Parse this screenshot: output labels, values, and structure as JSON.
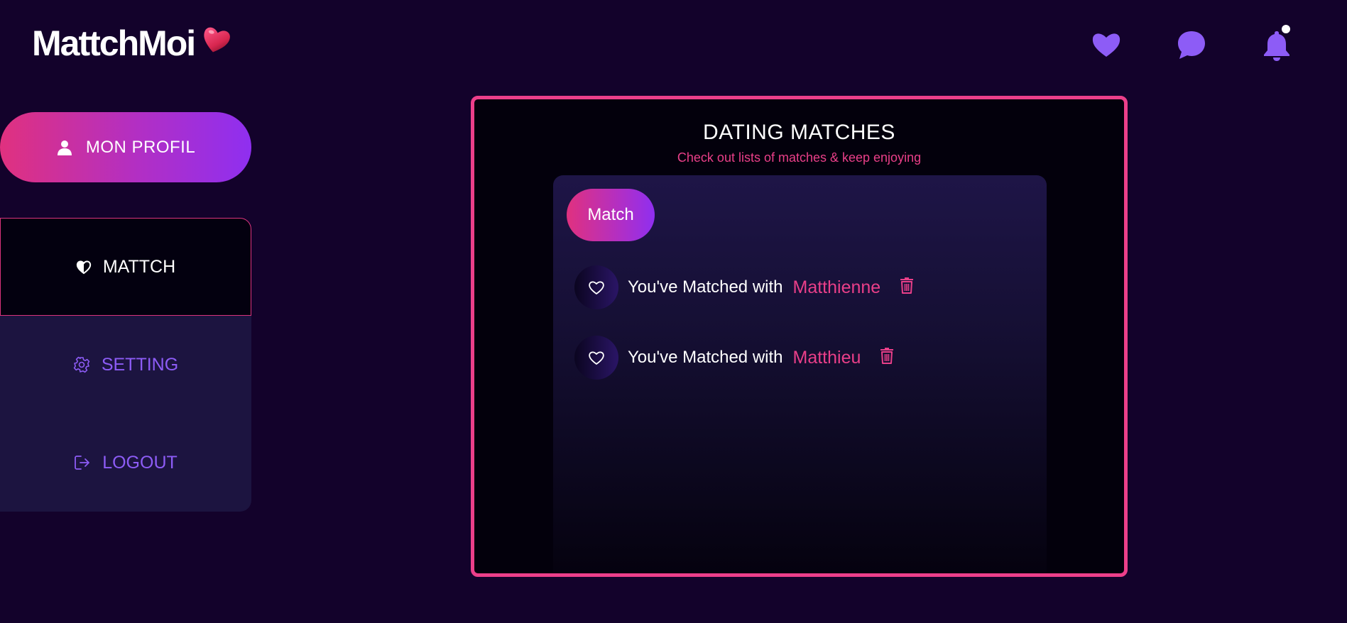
{
  "app": {
    "logo_text": "MattchMoi"
  },
  "colors": {
    "background": "#13022b",
    "accent_pink": "#ec3f8a",
    "accent_purple": "#8d5cf6",
    "gradient_start": "#e0317f",
    "gradient_end": "#8f2ff0"
  },
  "header": {
    "icons": [
      "heart-icon",
      "chat-bubble-icon",
      "bell-icon"
    ],
    "has_notification": true
  },
  "sidebar": {
    "profile_button": {
      "label": "MON PROFIL",
      "icon": "user-icon"
    },
    "items": [
      {
        "label": "MATTCH",
        "icon": "heart-shield-icon",
        "active": true
      },
      {
        "label": "SETTING",
        "icon": "gear-icon",
        "active": false
      },
      {
        "label": "LOGOUT",
        "icon": "logout-icon",
        "active": false
      }
    ]
  },
  "main": {
    "title": "DATING MATCHES",
    "subtitle": "Check out lists of matches & keep enjoying",
    "tab_label": "Match",
    "matches": [
      {
        "prefix": "You've Matched with",
        "name": "Matthienne"
      },
      {
        "prefix": "You've Matched with",
        "name": "Matthieu"
      }
    ]
  }
}
